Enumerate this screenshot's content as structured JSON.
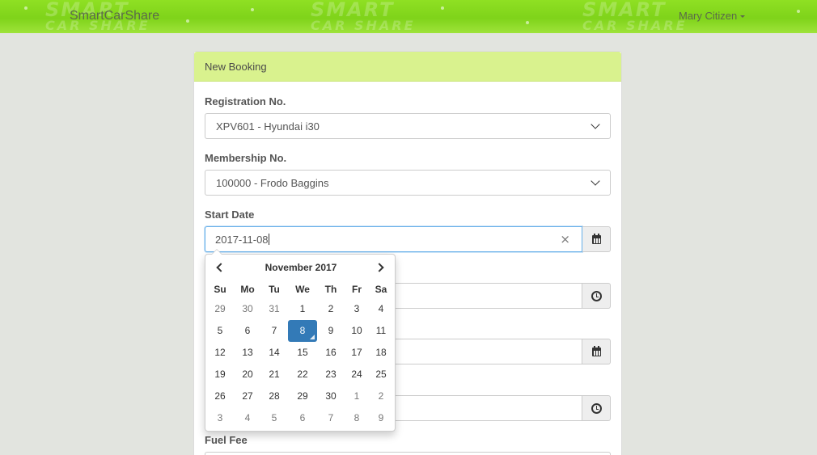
{
  "navbar": {
    "brand": "SmartCarShare",
    "user": "Mary Citizen",
    "watermark_top": "SMART",
    "watermark_bottom": "CAR SHARE"
  },
  "panel": {
    "title": "New Booking"
  },
  "form": {
    "registration": {
      "label": "Registration No.",
      "value": "XPV601 - Hyundai i30"
    },
    "membership": {
      "label": "Membership No.",
      "value": "100000 - Frodo Baggins"
    },
    "start_date": {
      "label": "Start Date",
      "value": "2017-11-08"
    },
    "fuel_fee": {
      "label": "Fuel Fee"
    }
  },
  "datepicker": {
    "title": "November 2017",
    "weekdays": [
      "Su",
      "Mo",
      "Tu",
      "We",
      "Th",
      "Fr",
      "Sa"
    ],
    "weeks": [
      [
        "29",
        "30",
        "31",
        "1",
        "2",
        "3",
        "4"
      ],
      [
        "5",
        "6",
        "7",
        "8",
        "9",
        "10",
        "11"
      ],
      [
        "12",
        "13",
        "14",
        "15",
        "16",
        "17",
        "18"
      ],
      [
        "19",
        "20",
        "21",
        "22",
        "23",
        "24",
        "25"
      ],
      [
        "26",
        "27",
        "28",
        "29",
        "30",
        "1",
        "2"
      ],
      [
        "3",
        "4",
        "5",
        "6",
        "7",
        "8",
        "9"
      ]
    ],
    "selected": "8",
    "colors": {
      "selected_bg": "#337ab7",
      "header_bg": "#d9f28e",
      "navbar_green": "#8fe023"
    }
  }
}
